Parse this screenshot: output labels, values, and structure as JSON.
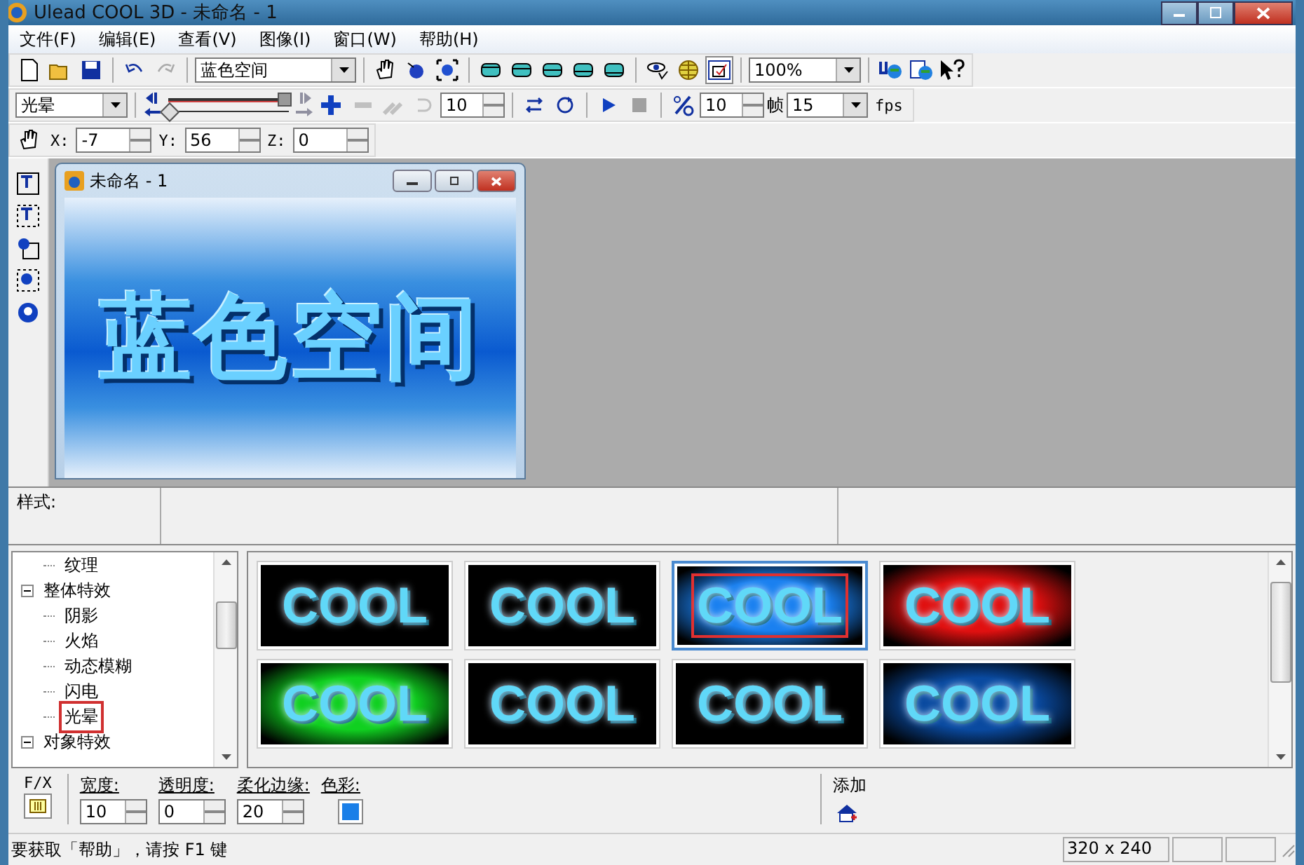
{
  "window": {
    "title": "Ulead COOL 3D - 未命名 - 1"
  },
  "menu": [
    "文件(F)",
    "编辑(E)",
    "查看(V)",
    "图像(I)",
    "窗口(W)",
    "帮助(H)"
  ],
  "toolbar": {
    "text_combo": "蓝色空间",
    "zoom_combo": "100%"
  },
  "animation_bar": {
    "effect_combo": "光晕",
    "timeline": {
      "level": 0
    },
    "frame_spin": "10",
    "percent_spin": "10",
    "frame_label": "帧",
    "fps_combo": "15",
    "fps_button": "fps"
  },
  "position_bar": {
    "fields": [
      {
        "label": "X:",
        "value": "-7"
      },
      {
        "label": "Y:",
        "value": "56"
      },
      {
        "label": "Z:",
        "value": "0"
      }
    ]
  },
  "document": {
    "title": "未命名 - 1",
    "canvas_text": "蓝色空间"
  },
  "style_bar": {
    "label": "样式:"
  },
  "tree": {
    "leading_children": [
      {
        "label": "纹理"
      }
    ],
    "items": [
      {
        "label": "整体特效",
        "expanded": true,
        "children": [
          {
            "label": "阴影",
            "selected": false
          },
          {
            "label": "火焰",
            "selected": false
          },
          {
            "label": "动态模糊",
            "selected": false
          },
          {
            "label": "闪电",
            "selected": false
          },
          {
            "label": "光晕",
            "selected": true
          }
        ]
      },
      {
        "label": "对象特效",
        "expanded": true
      }
    ]
  },
  "gallery": [
    {
      "label": "COOL",
      "color": "#000000",
      "selected": false
    },
    {
      "label": "COOL",
      "color": "#000000",
      "selected": false
    },
    {
      "label": "COOL",
      "color": "#1a80f0",
      "selected": true
    },
    {
      "label": "COOL",
      "color": "#e01010",
      "selected": false
    },
    {
      "label": "COOL",
      "color": "#10d020",
      "selected": false
    },
    {
      "label": "COOL",
      "color": "#000000",
      "selected": false
    },
    {
      "label": "COOL",
      "color": "#000000",
      "selected": false
    },
    {
      "label": "COOL",
      "color": "#0a4aa0",
      "selected": false
    }
  ],
  "properties": {
    "fx_label": "F/X",
    "fields": [
      {
        "label": "宽度:",
        "value": "10"
      },
      {
        "label": "透明度:",
        "value": "0"
      },
      {
        "label": "柔化边缘:",
        "value": "20"
      }
    ],
    "color_label": "色彩:",
    "color": "#1a7fe8",
    "add_label": "添加"
  },
  "status_bar": {
    "message": "要获取「帮助」，请按 F1 键",
    "size": "320 x 240"
  }
}
